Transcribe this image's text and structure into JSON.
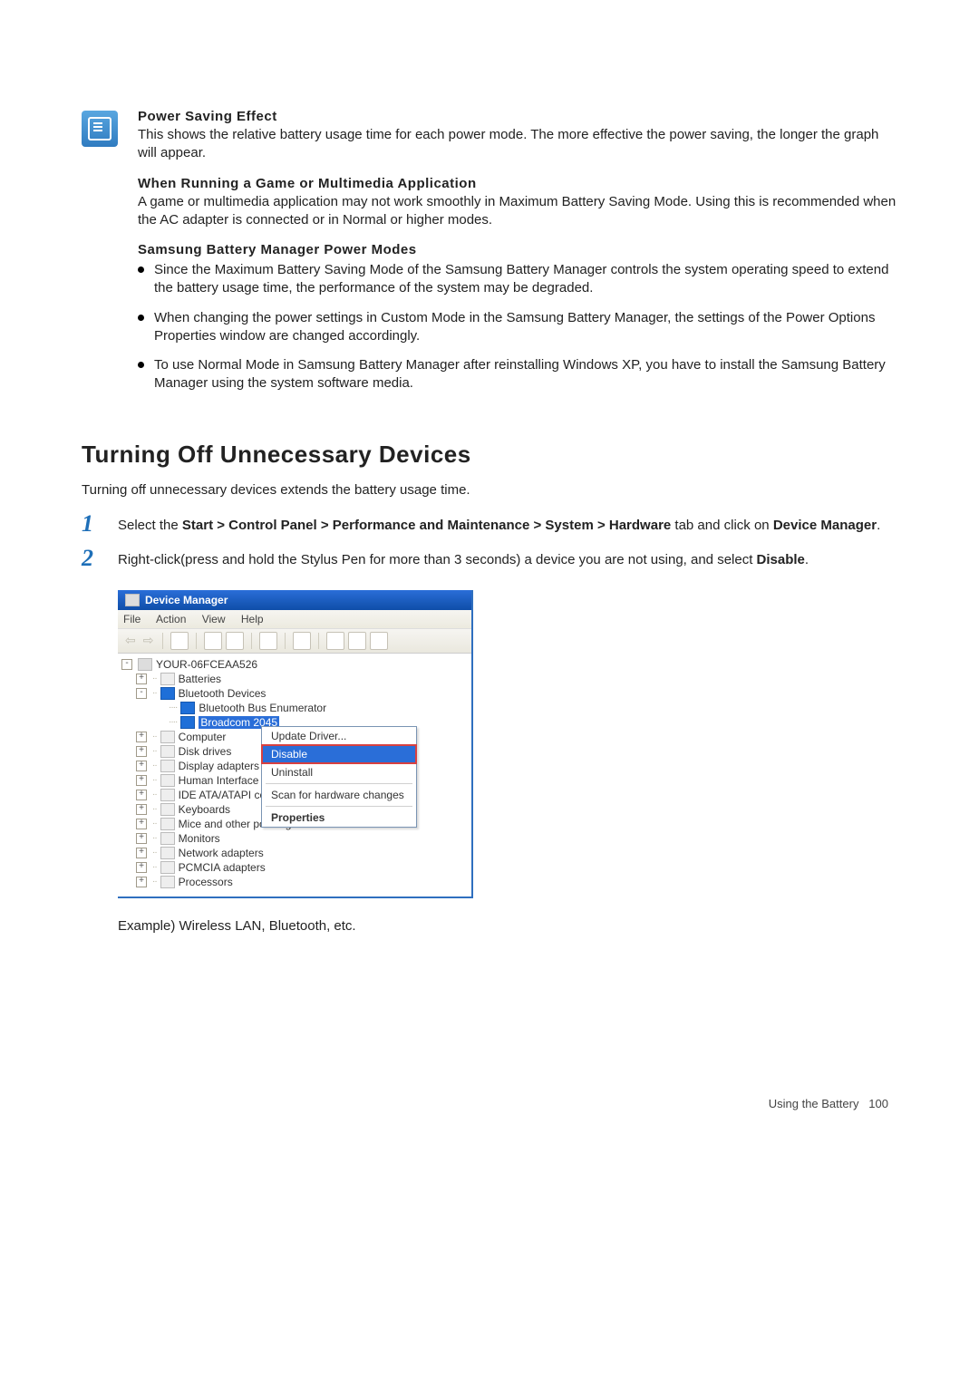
{
  "note": {
    "h1": "Power Saving Effect",
    "p1": "This shows the relative battery usage time for each power mode. The more effective the power saving, the longer the graph will appear.",
    "h2": "When Running a Game or Multimedia Application",
    "p2": "A game or multimedia application may not work smoothly in Maximum Battery Saving Mode. Using this is recommended when the AC adapter is connected or in Normal or higher modes.",
    "h3": "Samsung Battery Manager Power Modes",
    "b1": "Since the Maximum Battery Saving Mode of the Samsung Battery Manager controls the system operating speed to extend the battery usage time, the performance of the system may be degraded.",
    "b2": "When changing the power settings in Custom Mode in the Samsung Battery Manager, the settings of the Power Options Properties window are changed accordingly.",
    "b3": "To use Normal Mode in Samsung Battery Manager after reinstalling Windows XP, you have to install the Samsung Battery Manager using the system software media."
  },
  "section_title": "Turning Off Unnecessary Devices",
  "intro": "Turning off unnecessary devices extends the battery usage time.",
  "steps": {
    "n1": "1",
    "s1a": "Select the ",
    "s1b": "Start > Control Panel > Performance and Maintenance > System > Hardware",
    "s1c": " tab and click on ",
    "s1d": "Device Manager",
    "s1e": ".",
    "n2": "2",
    "s2a": "Right-click(press and hold the Stylus Pen for more than 3 seconds) a device you are not using, and select ",
    "s2b": "Disable",
    "s2c": "."
  },
  "dm": {
    "title": "Device Manager",
    "menu_file": "File",
    "menu_action": "Action",
    "menu_view": "View",
    "menu_help": "Help",
    "root": "YOUR-06FCEAA526",
    "batteries": "Batteries",
    "btdev": "Bluetooth Devices",
    "btbus": "Bluetooth Bus Enumerator",
    "broadcom": "Broadcom 2045",
    "computer": "Computer",
    "diskdrives": "Disk drives",
    "display": "Display adapters",
    "hid_clip": "Human Interface De",
    "ide_clip": "IDE ATA/ATAPI cont",
    "keyboards": "Keyboards",
    "mice": "Mice and other pointing devices",
    "monitors": "Monitors",
    "network": "Network adapters",
    "pcmcia": "PCMCIA adapters",
    "processors": "Processors"
  },
  "ctx": {
    "update": "Update Driver...",
    "disable": "Disable",
    "uninstall": "Uninstall",
    "scan": "Scan for hardware changes",
    "properties": "Properties"
  },
  "example": "Example) Wireless LAN, Bluetooth, etc.",
  "footer_label": "Using the Battery",
  "footer_page": "100"
}
